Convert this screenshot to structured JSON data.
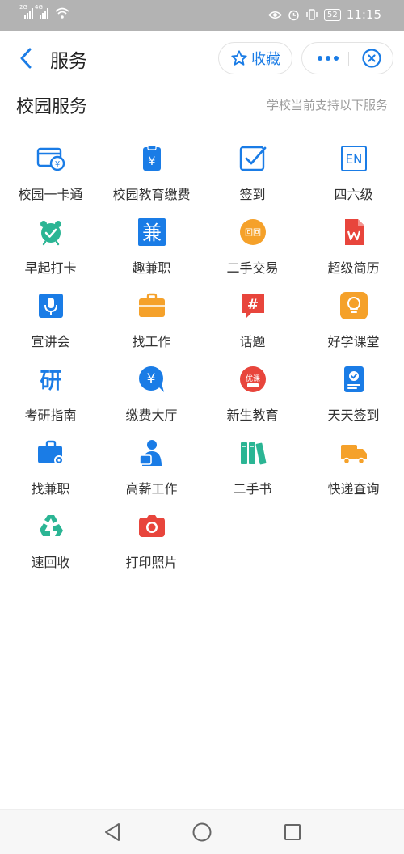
{
  "status_bar": {
    "signal1_tag": "2G",
    "signal2_tag": "4G",
    "battery": "52",
    "time": "11:15"
  },
  "nav": {
    "title": "服务",
    "favorite_label": "收藏"
  },
  "section": {
    "title": "校园服务",
    "note": "学校当前支持以下服务"
  },
  "services": [
    {
      "label": "校园一卡通",
      "icon": "campus-card-icon"
    },
    {
      "label": "校园教育缴费",
      "icon": "tuition-payment-icon"
    },
    {
      "label": "签到",
      "icon": "check-in-icon"
    },
    {
      "label": "四六级",
      "icon": "cet-en-icon",
      "icon_text": "EN"
    },
    {
      "label": "早起打卡",
      "icon": "alarm-clock-icon"
    },
    {
      "label": "趣兼职",
      "icon": "part-time-icon",
      "icon_text": "兼"
    },
    {
      "label": "二手交易",
      "icon": "second-hand-trade-icon",
      "icon_text": "回回"
    },
    {
      "label": "超级简历",
      "icon": "resume-icon"
    },
    {
      "label": "宣讲会",
      "icon": "microphone-icon"
    },
    {
      "label": "找工作",
      "icon": "briefcase-icon"
    },
    {
      "label": "话题",
      "icon": "topic-hash-icon",
      "icon_text": "#"
    },
    {
      "label": "好学课堂",
      "icon": "lightbulb-icon"
    },
    {
      "label": "考研指南",
      "icon": "postgraduate-icon",
      "icon_text": "研"
    },
    {
      "label": "缴费大厅",
      "icon": "payment-hall-icon",
      "icon_text": "¥"
    },
    {
      "label": "新生教育",
      "icon": "freshman-education-icon",
      "icon_text": "优课"
    },
    {
      "label": "天天签到",
      "icon": "daily-check-in-icon"
    },
    {
      "label": "找兼职",
      "icon": "toolbox-icon"
    },
    {
      "label": "高薪工作",
      "icon": "high-salary-job-icon"
    },
    {
      "label": "二手书",
      "icon": "books-icon"
    },
    {
      "label": "快递查询",
      "icon": "delivery-truck-icon"
    },
    {
      "label": "速回收",
      "icon": "recycle-icon"
    },
    {
      "label": "打印照片",
      "icon": "camera-icon"
    }
  ],
  "colors": {
    "accent_blue": "#1a7ce6",
    "teal": "#2bb594",
    "orange": "#f5a12a",
    "red": "#e8453c"
  }
}
